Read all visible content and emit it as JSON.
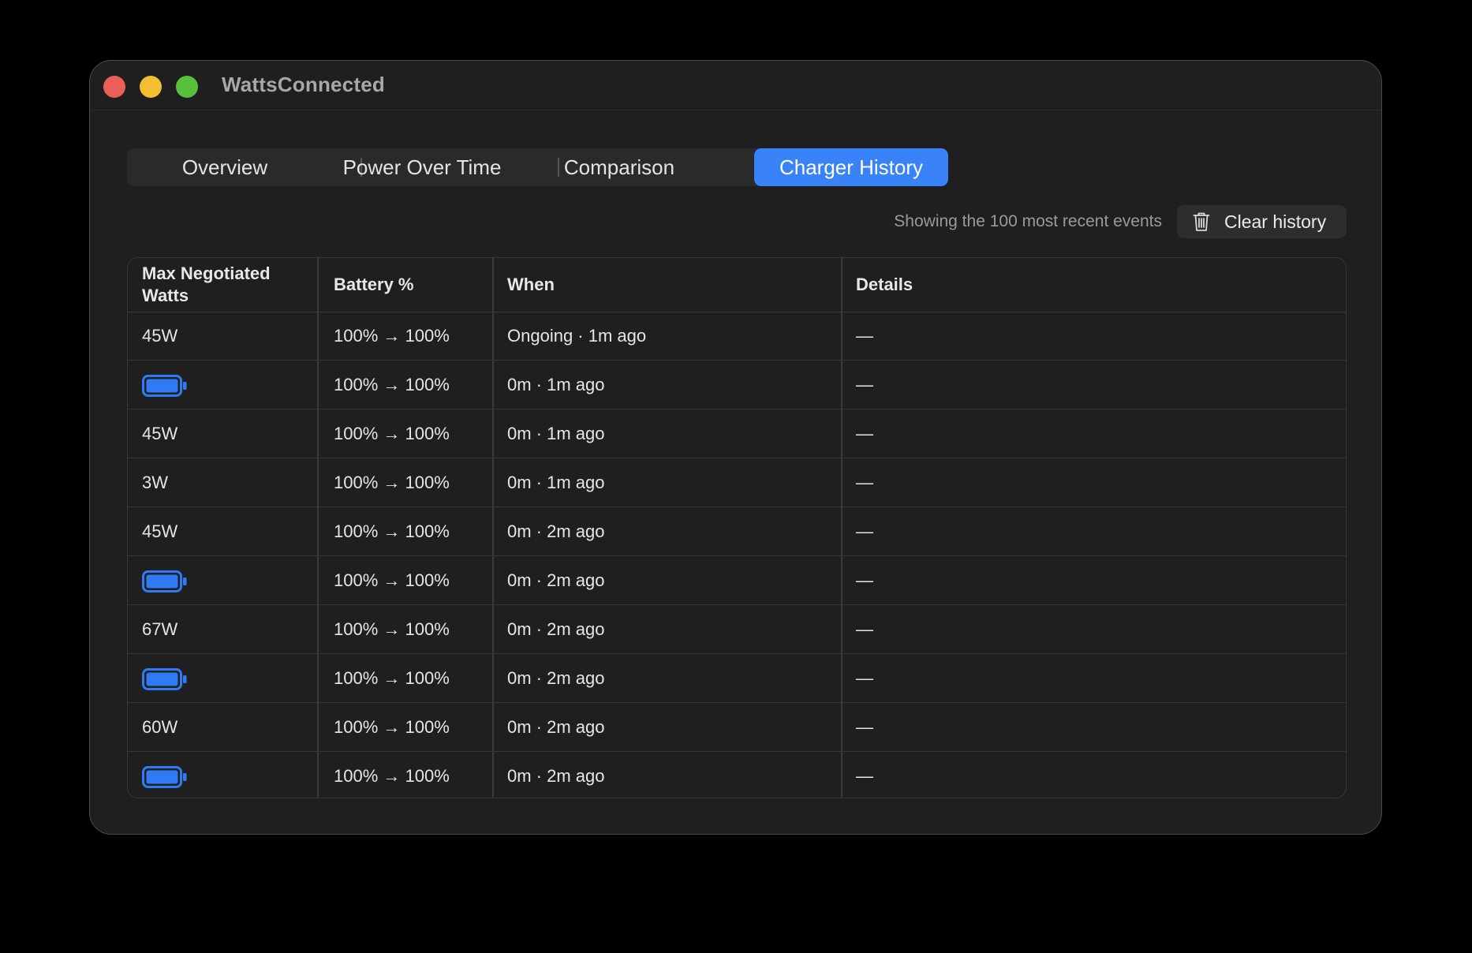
{
  "window": {
    "title": "WattsConnected"
  },
  "tabs": [
    {
      "label": "Overview",
      "selected": false
    },
    {
      "label": "Power Over Time",
      "selected": false
    },
    {
      "label": "Comparison",
      "selected": false
    },
    {
      "label": "Charger History",
      "selected": true
    }
  ],
  "toolbar": {
    "status_text": "Showing the 100 most recent events",
    "clear_label": "Clear history",
    "clear_icon": "trash-icon"
  },
  "table": {
    "headers": [
      "Max Negotiated Watts",
      "Battery %",
      "When",
      "Details"
    ],
    "rows": [
      {
        "watts": "45W",
        "battery_icon": false,
        "battery": "100% → 100%",
        "when": "Ongoing · 1m ago",
        "details": "—"
      },
      {
        "watts": "",
        "battery_icon": true,
        "battery": "100% → 100%",
        "when": "0m · 1m ago",
        "details": "—"
      },
      {
        "watts": "45W",
        "battery_icon": false,
        "battery": "100% → 100%",
        "when": "0m · 1m ago",
        "details": "—"
      },
      {
        "watts": "3W",
        "battery_icon": false,
        "battery": "100% → 100%",
        "when": "0m · 1m ago",
        "details": "—"
      },
      {
        "watts": "45W",
        "battery_icon": false,
        "battery": "100% → 100%",
        "when": "0m · 2m ago",
        "details": "—"
      },
      {
        "watts": "",
        "battery_icon": true,
        "battery": "100% → 100%",
        "when": "0m · 2m ago",
        "details": "—"
      },
      {
        "watts": "67W",
        "battery_icon": false,
        "battery": "100% → 100%",
        "when": "0m · 2m ago",
        "details": "—"
      },
      {
        "watts": "",
        "battery_icon": true,
        "battery": "100% → 100%",
        "when": "0m · 2m ago",
        "details": "—"
      },
      {
        "watts": "60W",
        "battery_icon": false,
        "battery": "100% → 100%",
        "when": "0m · 2m ago",
        "details": "—"
      },
      {
        "watts": "",
        "battery_icon": true,
        "battery": "100% → 100%",
        "when": "0m · 2m ago",
        "details": "—"
      }
    ]
  },
  "colors": {
    "accent": "#3a82f7",
    "battery_icon": "#2f7bf6",
    "window_bg": "#1f1f1f"
  }
}
